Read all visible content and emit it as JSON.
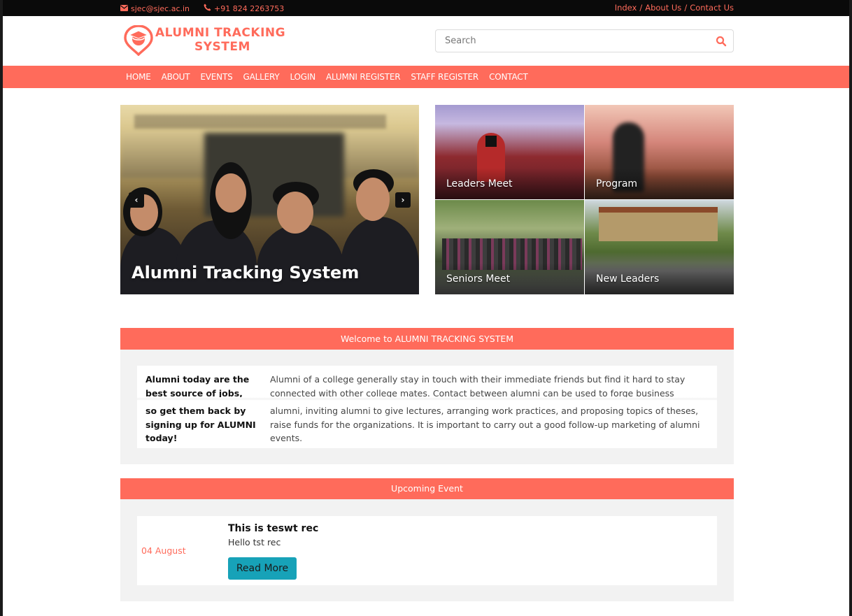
{
  "topbar": {
    "email": "sjec@sjec.ac.in",
    "phone": "+91 824 2263753",
    "links": [
      "Index",
      "About Us",
      "Contact Us"
    ],
    "separator": "/"
  },
  "logo": {
    "line1": "ALUMNI TRACKING",
    "line2": "SYSTEM"
  },
  "search": {
    "placeholder": "Search"
  },
  "nav": {
    "items": [
      "HOME",
      "ABOUT",
      "EVENTS",
      "GALLERY",
      "LOGIN",
      "ALUMNI REGISTER",
      "STAFF REGISTER",
      "CONTACT"
    ]
  },
  "hero": {
    "caption": "Alumni Tracking System",
    "prev": "‹",
    "next": "›"
  },
  "tiles": [
    "Leaders Meet",
    "Program",
    "Seniors Meet",
    "New Leaders"
  ],
  "welcome": {
    "heading": "Welcome to ALUMNI TRACKING SYSTEM",
    "tagline_top": "Alumni today are the best source of jobs,",
    "tagline_bottom": "so get them back by signing up for ALUMNI today!",
    "text_top": "Alumni of a college generally stay in touch with their immediate friends but find it hard to stay connected with other college mates. Contact between alumni can be used to forge business",
    "text_bottom": "alumni, inviting alumni to give lectures, arranging work practices, and proposing topics of theses, raise funds for the organizations. It is important to carry out a good follow-up marketing of alumni events."
  },
  "events": {
    "heading": "Upcoming Event",
    "items": [
      {
        "date": "04 August",
        "title": "This is teswt rec",
        "description": "Hello tst rec",
        "button": "Read More"
      }
    ]
  },
  "colors": {
    "accent": "#ff6b5b",
    "button": "#17a2b8",
    "topbar": "#0a0a0a"
  }
}
